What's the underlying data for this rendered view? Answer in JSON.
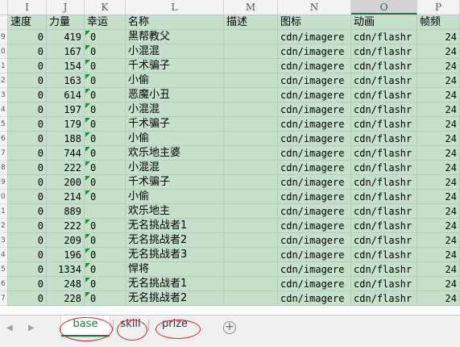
{
  "columns": [
    "I",
    "J",
    "K",
    "L",
    "M",
    "N",
    "O",
    "P"
  ],
  "selected_column": "O",
  "header_row": {
    "row_number": "",
    "cells": [
      "速度",
      "力量",
      "幸运",
      "名称",
      "描述",
      "图标",
      "动画",
      "帧频"
    ]
  },
  "rows": [
    {
      "n": "9",
      "speed": "0",
      "power": "419",
      "luck": "0",
      "name": "黑帮教父",
      "desc": "",
      "icon": "cdn/imagere",
      "anim": "cdn/flashr",
      "fps": "24"
    },
    {
      "n": "0",
      "speed": "0",
      "power": "167",
      "luck": "0",
      "name": "小混混",
      "desc": "",
      "icon": "cdn/imagere",
      "anim": "cdn/flashr",
      "fps": "24"
    },
    {
      "n": "1",
      "speed": "0",
      "power": "154",
      "luck": "0",
      "name": "千术骗子",
      "desc": "",
      "icon": "cdn/imagere",
      "anim": "cdn/flashr",
      "fps": "24"
    },
    {
      "n": "2",
      "speed": "0",
      "power": "163",
      "luck": "0",
      "name": "小偷",
      "desc": "",
      "icon": "cdn/imagere",
      "anim": "cdn/flashr",
      "fps": "24"
    },
    {
      "n": "3",
      "speed": "0",
      "power": "614",
      "luck": "0",
      "name": "恶魔小丑",
      "desc": "",
      "icon": "cdn/imagere",
      "anim": "cdn/flashr",
      "fps": "24"
    },
    {
      "n": "4",
      "speed": "0",
      "power": "197",
      "luck": "0",
      "name": "小混混",
      "desc": "",
      "icon": "cdn/imagere",
      "anim": "cdn/flashr",
      "fps": "24"
    },
    {
      "n": "5",
      "speed": "0",
      "power": "179",
      "luck": "0",
      "name": "千术骗子",
      "desc": "",
      "icon": "cdn/imagere",
      "anim": "cdn/flashr",
      "fps": "24"
    },
    {
      "n": "6",
      "speed": "0",
      "power": "188",
      "luck": "0",
      "name": "小偷",
      "desc": "",
      "icon": "cdn/imagere",
      "anim": "cdn/flashr",
      "fps": "24"
    },
    {
      "n": "7",
      "speed": "0",
      "power": "744",
      "luck": "0",
      "name": "欢乐地主婆",
      "desc": "",
      "icon": "cdn/imagere",
      "anim": "cdn/flashr",
      "fps": "24"
    },
    {
      "n": "8",
      "speed": "0",
      "power": "222",
      "luck": "0",
      "name": "小混混",
      "desc": "",
      "icon": "cdn/imagere",
      "anim": "cdn/flashr",
      "fps": "24"
    },
    {
      "n": "9",
      "speed": "0",
      "power": "200",
      "luck": "0",
      "name": "千术骗子",
      "desc": "",
      "icon": "cdn/imagere",
      "anim": "cdn/flashr",
      "fps": "24"
    },
    {
      "n": "0",
      "speed": "0",
      "power": "214",
      "luck": "0",
      "name": "小偷",
      "desc": "",
      "icon": "cdn/imagere",
      "anim": "cdn/flashr",
      "fps": "24"
    },
    {
      "n": "1",
      "speed": "0",
      "power": "889",
      "luck": "",
      "name": "欢乐地主",
      "desc": "",
      "icon": "cdn/imagere",
      "anim": "cdn/flashr",
      "fps": "24"
    },
    {
      "n": "2",
      "speed": "0",
      "power": "222",
      "luck": "0",
      "name": "无名挑战者1",
      "desc": "",
      "icon": "cdn/imagere",
      "anim": "cdn/flashr",
      "fps": "24"
    },
    {
      "n": "3",
      "speed": "0",
      "power": "209",
      "luck": "0",
      "name": "无名挑战者2",
      "desc": "",
      "icon": "cdn/imagere",
      "anim": "cdn/flashr",
      "fps": "24"
    },
    {
      "n": "4",
      "speed": "0",
      "power": "196",
      "luck": "0",
      "name": "无名挑战者3",
      "desc": "",
      "icon": "cdn/imagere",
      "anim": "cdn/flashr",
      "fps": "24"
    },
    {
      "n": "5",
      "speed": "0",
      "power": "1334",
      "luck": "0",
      "name": "悍将",
      "desc": "",
      "icon": "cdn/imagere",
      "anim": "cdn/flashr",
      "fps": "24"
    },
    {
      "n": "6",
      "speed": "0",
      "power": "248",
      "luck": "0",
      "name": "无名挑战者1",
      "desc": "",
      "icon": "cdn/imagere",
      "anim": "cdn/flashr",
      "fps": "24"
    },
    {
      "n": "7",
      "speed": "0",
      "power": "228",
      "luck": "0",
      "name": "无名挑战者2",
      "desc": "",
      "icon": "cdn/imagere",
      "anim": "cdn/flashr",
      "fps": "24"
    }
  ],
  "tabs": {
    "prev_icon": "triangle-left-icon",
    "next_icon": "triangle-right-icon",
    "items": [
      {
        "label": "base",
        "active": true
      },
      {
        "label": "skill",
        "active": false
      },
      {
        "label": "prize",
        "active": false
      }
    ],
    "add_symbol": "+",
    "annotation_color": "#e02020",
    "accent_color": "#217346"
  },
  "colors": {
    "cell_fill": "#c6e0cc",
    "comment_marker": "#1f8a3c"
  }
}
